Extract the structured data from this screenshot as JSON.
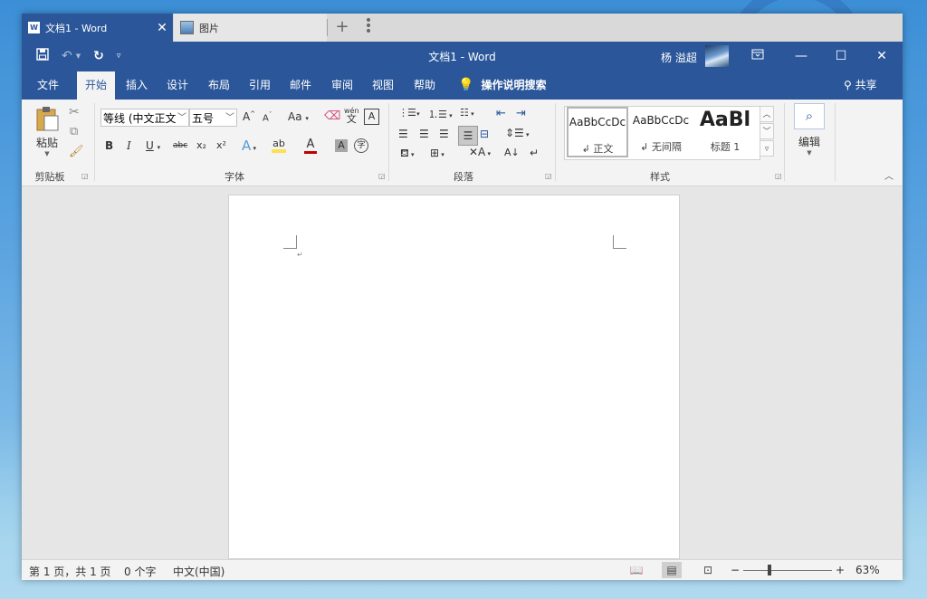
{
  "tabs": {
    "active": {
      "label": "文档1 - Word",
      "close": "✕"
    },
    "inactive": {
      "label": "图片"
    },
    "new_tab": "+",
    "more": "⋮"
  },
  "titlebar": {
    "title": "文档1  -  Word",
    "user": "杨 溢超"
  },
  "ribbon_tabs": [
    "文件",
    "开始",
    "插入",
    "设计",
    "布局",
    "引用",
    "邮件",
    "审阅",
    "视图",
    "帮助"
  ],
  "selected_tab": "开始",
  "tell_me": "操作说明搜索",
  "share": "共享",
  "clipboard": {
    "paste": "粘贴",
    "group": "剪贴板"
  },
  "font": {
    "name": "等线 (中文正文)",
    "size": "五号",
    "case": "Aa",
    "group": "字体",
    "bold": "B",
    "italic": "I",
    "underline": "U",
    "strike": "abc",
    "subscript": "x₂",
    "superscript": "x²"
  },
  "paragraph": {
    "group": "段落"
  },
  "styles": {
    "group": "样式",
    "items": [
      {
        "sample": "AaBbCcDc",
        "name": "↲ 正文"
      },
      {
        "sample": "AaBbCcDc",
        "name": "↲ 无间隔"
      },
      {
        "sample": "AaBl",
        "name": "标题 1"
      }
    ]
  },
  "editing": {
    "label": "编辑"
  },
  "statusbar": {
    "page": "第 1 页，共 1 页",
    "words": "0 个字",
    "language": "中文(中国)",
    "zoom": "63%",
    "zoom_minus": "−",
    "zoom_plus": "+"
  },
  "colors": {
    "brand": "#2b579a",
    "highlight": "#ffe14d",
    "font_color": "#c00000"
  },
  "zoom_percent": 63
}
